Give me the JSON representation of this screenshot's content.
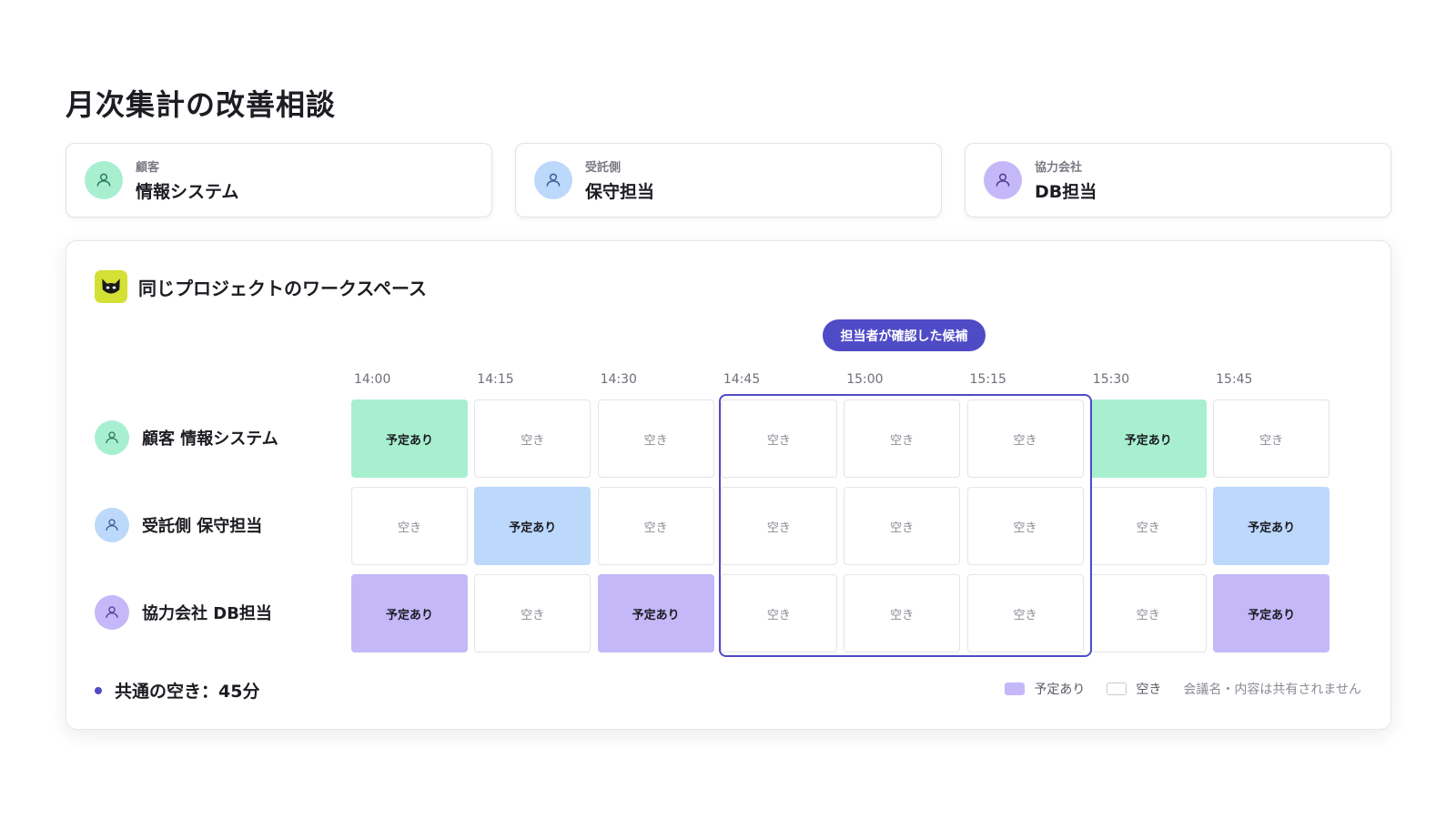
{
  "page": {
    "title": "月次集計の改善相談"
  },
  "colors": {
    "accent": "#4f4bc7",
    "customer": "#a8efd0",
    "contractor": "#bcd8fb",
    "partner": "#c5b8f8"
  },
  "participants": [
    {
      "role": "顧客",
      "name": "情報システム",
      "avatar_icon": "person-icon"
    },
    {
      "role": "受託側",
      "name": "保守担当",
      "avatar_icon": "person-icon"
    },
    {
      "role": "協力会社",
      "name": "DB担当",
      "avatar_icon": "person-icon"
    }
  ],
  "workspace": {
    "logo_icon": "cat-face-icon",
    "title": "同じプロジェクトのワークスペース",
    "candidate_badge": "担当者が確認した候補",
    "times": [
      "14:00",
      "14:15",
      "14:30",
      "14:45",
      "15:00",
      "15:15",
      "15:30",
      "15:45"
    ],
    "selected_range": [
      3,
      5
    ],
    "busy_label": "予定あり",
    "free_label": "空き",
    "rows": [
      {
        "label": "顧客 情報システム",
        "slots": [
          "busy",
          "free",
          "free",
          "free",
          "free",
          "free",
          "busy",
          "free"
        ]
      },
      {
        "label": "受託側 保守担当",
        "slots": [
          "free",
          "busy",
          "free",
          "free",
          "free",
          "free",
          "free",
          "busy"
        ]
      },
      {
        "label": "協力会社 DB担当",
        "slots": [
          "busy",
          "free",
          "busy",
          "free",
          "free",
          "free",
          "free",
          "busy"
        ]
      }
    ],
    "common_free": "共通の空き：45分",
    "legend": {
      "busy": "予定あり",
      "free": "空き",
      "note": "会議名・内容は共有されません"
    }
  }
}
